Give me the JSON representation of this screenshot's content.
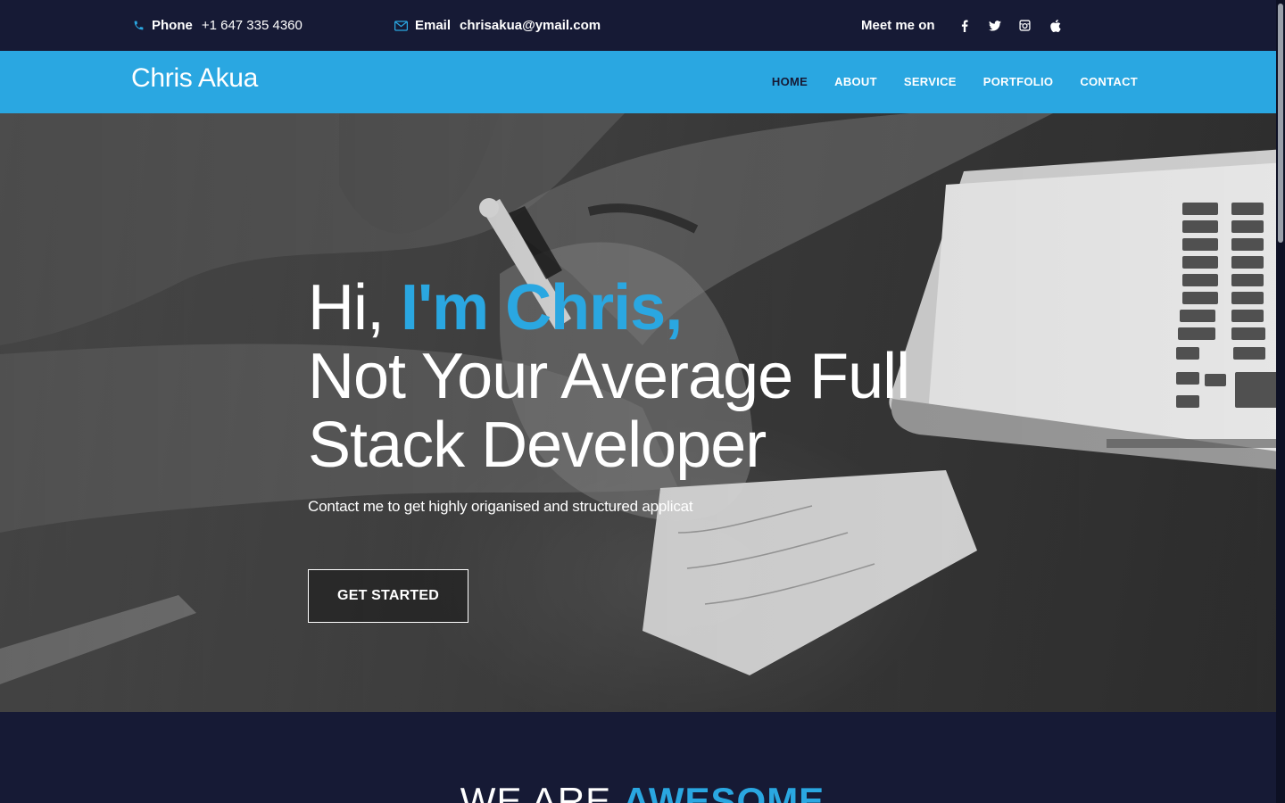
{
  "topbar": {
    "phone_label": "Phone",
    "phone_value": "+1 647 335 4360",
    "email_label": "Email",
    "email_value": "chrisakua@ymail.com",
    "meet_label": "Meet me on",
    "social": [
      "facebook-icon",
      "twitter-icon",
      "instagram-icon",
      "apple-icon"
    ]
  },
  "nav": {
    "brand": "Chris Akua",
    "items": [
      {
        "label": "HOME",
        "active": true
      },
      {
        "label": "ABOUT"
      },
      {
        "label": "SERVICE"
      },
      {
        "label": "PORTFOLIO"
      },
      {
        "label": "CONTACT"
      }
    ]
  },
  "hero": {
    "greeting": "Hi, ",
    "name_accent": "I'm Chris,",
    "line2": "Not Your Average Full",
    "line3": "Stack Developer",
    "subtitle": "Contact me to get highly origanised and structured applicat",
    "cta": "GET STARTED"
  },
  "section2": {
    "title_plain": "WE ARE ",
    "title_accent": "AWESOME"
  },
  "colors": {
    "accent": "#2aa7e1",
    "dark": "#161a35"
  }
}
